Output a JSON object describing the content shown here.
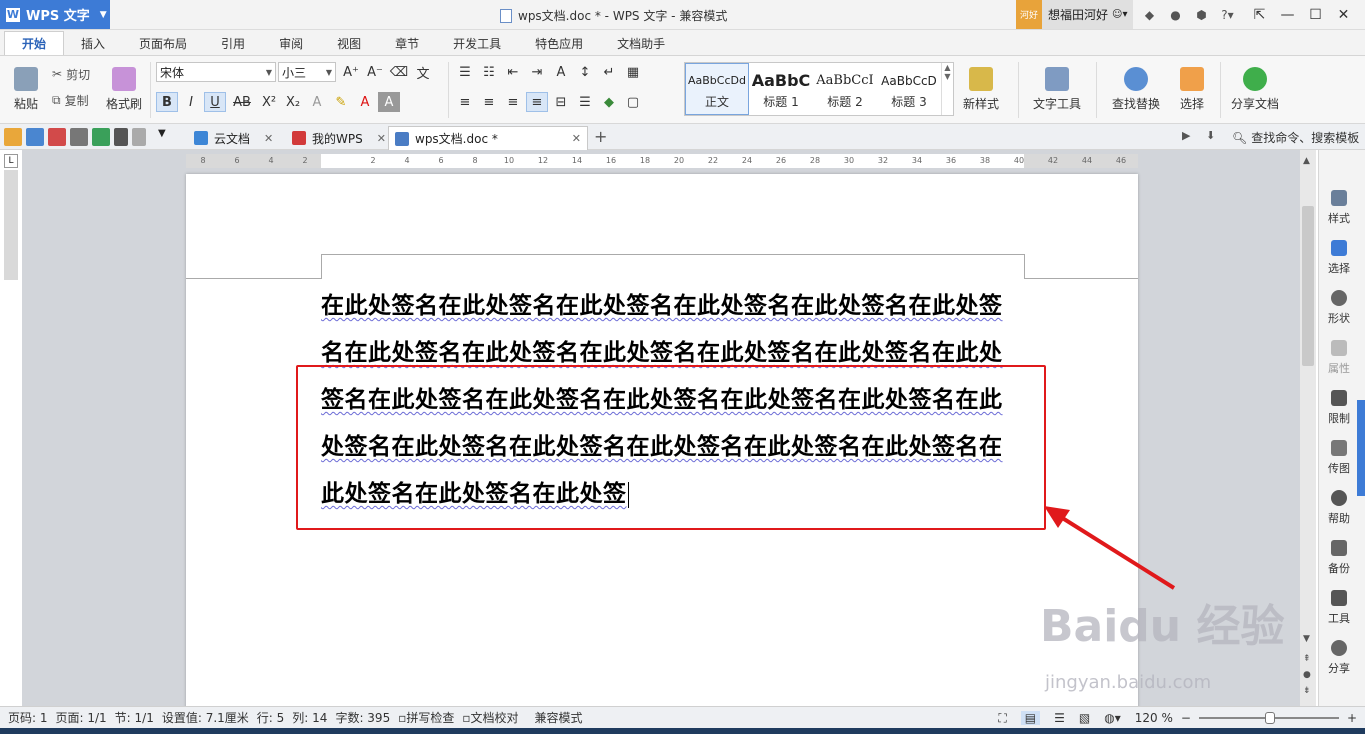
{
  "titlebar": {
    "app_name": "WPS 文字",
    "doc_title": "wps文档.doc * - WPS 文字 - 兼容模式",
    "user_avatar_text": "河好",
    "user_name": "想福田河好"
  },
  "menu": {
    "tabs": [
      "开始",
      "插入",
      "页面布局",
      "引用",
      "审阅",
      "视图",
      "章节",
      "开发工具",
      "特色应用",
      "文档助手"
    ]
  },
  "ribbon": {
    "paste": "粘贴",
    "cut": "剪切",
    "copy": "复制",
    "format_painter": "格式刷",
    "font_name": "宋体",
    "font_size": "小三",
    "styles": [
      {
        "sample": "AaBbCcDd",
        "label": "正文"
      },
      {
        "sample": "AaBbC",
        "label": "标题 1"
      },
      {
        "sample": "AaBbCcI",
        "label": "标题 2"
      },
      {
        "sample": "AaBbCcD",
        "label": "标题 3"
      }
    ],
    "new_style": "新样式",
    "text_tools": "文字工具",
    "find_replace": "查找替换",
    "select": "选择",
    "share_doc": "分享文档"
  },
  "doctabs": {
    "tabs": [
      {
        "label": "云文档"
      },
      {
        "label": "我的WPS"
      },
      {
        "label": "wps文档.doc *"
      }
    ],
    "search_placeholder": "查找命令、搜索模板"
  },
  "ruler": {
    "h_ticks": [
      "8",
      "6",
      "4",
      "2",
      "",
      "2",
      "4",
      "6",
      "8",
      "10",
      "12",
      "14",
      "16",
      "18",
      "20",
      "22",
      "24",
      "26",
      "28",
      "30",
      "32",
      "34",
      "36",
      "38",
      "40",
      "42",
      "44",
      "46"
    ]
  },
  "document": {
    "lines": [
      "在此处签名在此处签名在此处签名在此处签名在此处签名在此处签",
      "名在此处签名在此处签名在此处签名在此处签名在此处签名在此处",
      "签名在此处签名在此处签名在此处签名在此处签名在此处签名在此",
      "处签名在此处签名在此处签名在此处签名在此处签名在此处签名在",
      "此处签名在此处签名在此处签"
    ]
  },
  "sidepanel": {
    "items": [
      "样式",
      "选择",
      "形状",
      "属性",
      "限制",
      "传图",
      "帮助",
      "备份",
      "工具",
      "分享"
    ]
  },
  "status": {
    "page_no": "页码: 1",
    "pages": "页面: 1/1",
    "section": "节: 1/1",
    "setting": "设置值: 7.1厘米",
    "row": "行: 5",
    "col": "列: 14",
    "word_count": "字数: 395",
    "spellcheck": "拼写检查",
    "proofread": "文档校对",
    "mode": "兼容模式",
    "zoom": "120 %"
  },
  "watermark": {
    "brand": "Baidu 经验",
    "url": "jingyan.baidu.com"
  },
  "colors": {
    "accent": "#3d7bd6",
    "highlight_box": "#e0191b"
  }
}
